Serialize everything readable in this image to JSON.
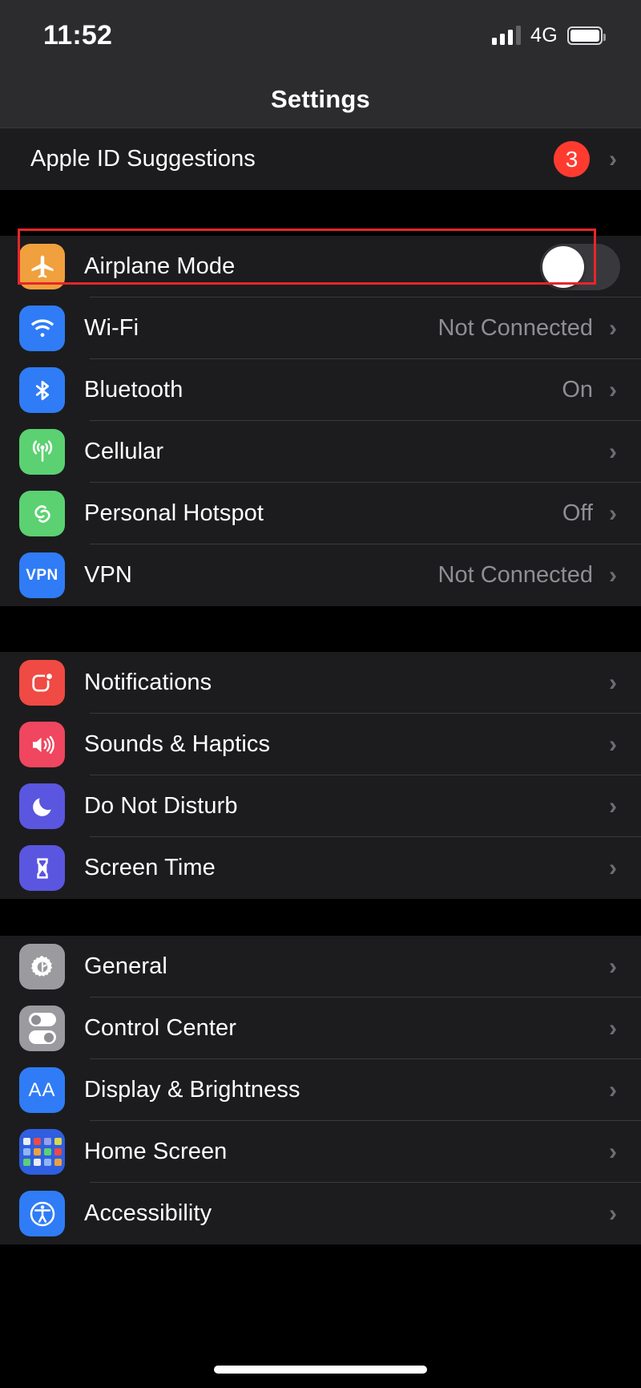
{
  "status_bar": {
    "time": "11:52",
    "network": "4G",
    "signal_bars_filled": 3,
    "signal_bars_total": 4,
    "battery_icon": "battery-full-icon"
  },
  "nav": {
    "title": "Settings"
  },
  "highlight": {
    "target": "Airplane Mode",
    "color": "#e8252a"
  },
  "groups": [
    {
      "id": "suggestions",
      "rows": [
        {
          "label": "Apple ID Suggestions",
          "type": "plain",
          "badge": "3",
          "badge_color": "#ff3b30",
          "accessory": "chevron",
          "chevron": "›"
        }
      ]
    },
    {
      "id": "connectivity",
      "rows": [
        {
          "label": "Airplane Mode",
          "icon": "airplane-icon",
          "icon_color": "#f0a03c",
          "accessory": "toggle",
          "toggle_on": false,
          "highlighted": true
        },
        {
          "label": "Wi-Fi",
          "icon": "wifi-icon",
          "icon_color": "#2f7cf6",
          "value": "Not Connected",
          "accessory": "chevron",
          "chevron": "›"
        },
        {
          "label": "Bluetooth",
          "icon": "bluetooth-icon",
          "icon_color": "#2f7cf6",
          "value": "On",
          "accessory": "chevron",
          "chevron": "›"
        },
        {
          "label": "Cellular",
          "icon": "cellular-antenna-icon",
          "icon_color": "#5bd172",
          "value": "",
          "accessory": "chevron",
          "chevron": "›"
        },
        {
          "label": "Personal Hotspot",
          "icon": "hotspot-link-icon",
          "icon_color": "#5bd172",
          "value": "Off",
          "accessory": "chevron",
          "chevron": "›"
        },
        {
          "label": "VPN",
          "icon": "vpn-icon",
          "icon_color": "#2f7cf6",
          "icon_text": "VPN",
          "value": "Not Connected",
          "accessory": "chevron",
          "chevron": "›"
        }
      ]
    },
    {
      "id": "alerts",
      "rows": [
        {
          "label": "Notifications",
          "icon": "notifications-badge-icon",
          "icon_color": "#ef4a43",
          "accessory": "chevron",
          "chevron": "›"
        },
        {
          "label": "Sounds & Haptics",
          "icon": "speaker-waves-icon",
          "icon_color": "#f0465f",
          "accessory": "chevron",
          "chevron": "›"
        },
        {
          "label": "Do Not Disturb",
          "icon": "moon-icon",
          "icon_color": "#5a56e0",
          "accessory": "chevron",
          "chevron": "›"
        },
        {
          "label": "Screen Time",
          "icon": "hourglass-icon",
          "icon_color": "#5a56e0",
          "accessory": "chevron",
          "chevron": "›"
        }
      ]
    },
    {
      "id": "system",
      "rows": [
        {
          "label": "General",
          "icon": "gear-icon",
          "icon_color": "#8e8e93",
          "accessory": "chevron",
          "chevron": "›"
        },
        {
          "label": "Control Center",
          "icon": "control-center-toggles-icon",
          "icon_color": "#8e8e93",
          "accessory": "chevron",
          "chevron": "›"
        },
        {
          "label": "Display & Brightness",
          "icon": "display-brightness-icon",
          "icon_color": "#2f7cf6",
          "icon_text": "AA",
          "accessory": "chevron",
          "chevron": "›"
        },
        {
          "label": "Home Screen",
          "icon": "home-screen-grid-icon",
          "icon_color": "#2f5fe0",
          "accessory": "chevron",
          "chevron": "›"
        },
        {
          "label": "Accessibility",
          "icon": "accessibility-person-icon",
          "icon_color": "#2f7cf6",
          "accessory": "chevron",
          "chevron": "›"
        }
      ]
    }
  ]
}
